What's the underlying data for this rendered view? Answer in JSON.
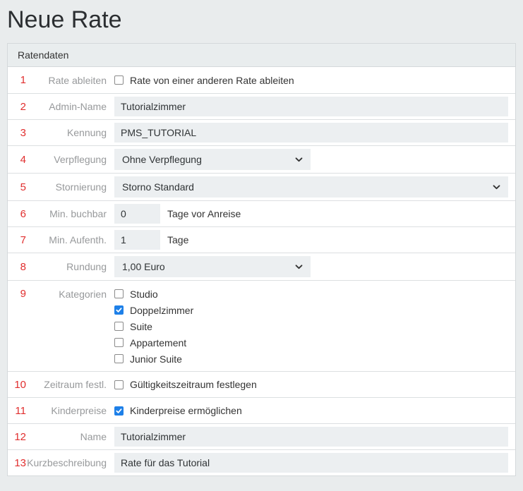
{
  "page": {
    "title": "Neue Rate"
  },
  "panel": {
    "title": "Ratendaten",
    "rows": [
      {
        "number": "1",
        "label": "Rate ableiten",
        "checkbox_label": "Rate von einer anderen Rate ableiten",
        "checked": false
      },
      {
        "number": "2",
        "label": "Admin-Name",
        "value": "Tutorialzimmer"
      },
      {
        "number": "3",
        "label": "Kennung",
        "value": "PMS_TUTORIAL"
      },
      {
        "number": "4",
        "label": "Verpflegung",
        "value": "Ohne Verpflegung"
      },
      {
        "number": "5",
        "label": "Stornierung",
        "value": "Storno Standard"
      },
      {
        "number": "6",
        "label": "Min. buchbar",
        "value": "0",
        "suffix": "Tage vor Anreise"
      },
      {
        "number": "7",
        "label": "Min. Aufenth.",
        "value": "1",
        "suffix": "Tage"
      },
      {
        "number": "8",
        "label": "Rundung",
        "value": "1,00 Euro"
      },
      {
        "number": "9",
        "label": "Kategorien",
        "options": [
          {
            "label": "Studio",
            "checked": false
          },
          {
            "label": "Doppelzimmer",
            "checked": true
          },
          {
            "label": "Suite",
            "checked": false
          },
          {
            "label": "Appartement",
            "checked": false
          },
          {
            "label": "Junior Suite",
            "checked": false
          }
        ]
      },
      {
        "number": "10",
        "label": "Zeitraum festl.",
        "checkbox_label": "Gültigkeitszeitraum festlegen",
        "checked": false
      },
      {
        "number": "11",
        "label": "Kinderpreise",
        "checkbox_label": "Kinderpreise ermöglichen",
        "checked": true
      },
      {
        "number": "12",
        "label": "Name",
        "value": "Tutorialzimmer"
      },
      {
        "number": "13",
        "label": "Kurzbeschreibung",
        "value": "Rate für das Tutorial"
      }
    ]
  },
  "colors": {
    "row_number_red": "#e12e2e",
    "checkbox_checked_blue": "#1e80e8",
    "input_background": "#eceff1",
    "page_background": "#e9eced"
  }
}
